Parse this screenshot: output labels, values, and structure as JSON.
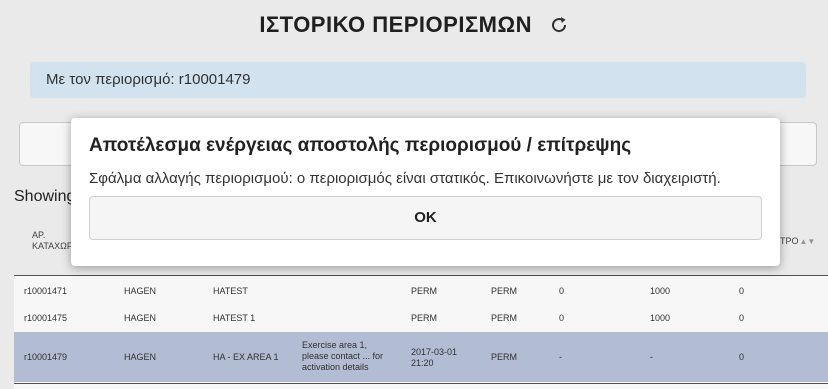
{
  "header": {
    "title": "ΙΣΤΟΡΙΚΟ ΠΕΡΙΟΡΙΣΜΩΝ",
    "refresh_icon": "refresh-icon"
  },
  "info_bar": {
    "text": "Με τον περιορισμό: r10001479"
  },
  "table_info": {
    "showing_text": "Showing"
  },
  "table": {
    "headers": [
      {
        "line1": "ΑΡ.",
        "line2": "ΚΑΤΑΧΩΡ"
      },
      {
        "line1": "ΕΤΡΟ",
        "line2": ""
      }
    ],
    "rows": [
      {
        "id": "r10001471",
        "owner": "HAGEN",
        "name": "HATEST",
        "description": "",
        "from": "PERM",
        "to": "PERM",
        "lower": "0",
        "upper": "1000",
        "value": "0"
      },
      {
        "id": "r10001475",
        "owner": "HAGEN",
        "name": "HATEST 1",
        "description": "",
        "from": "PERM",
        "to": "PERM",
        "lower": "0",
        "upper": "1000",
        "value": "0"
      },
      {
        "id": "r10001479",
        "owner": "HAGEN",
        "name": "HA - EX AREA 1",
        "description": "Exercise area 1, please contact ... for activation details",
        "from": "2017-03-01 21:20",
        "to": "PERM",
        "lower": "-",
        "upper": "-",
        "value": "0"
      }
    ]
  },
  "modal": {
    "title": "Αποτέλεσμα ενέργειας αποστολής περιορισμού / επίτρεψης",
    "message": "Σφάλμα αλλαγής περιορισμού: ο περιορισμός είναι στατικός. Επικοινωνήστε με τον διαχειριστή.",
    "ok_label": "OK"
  }
}
